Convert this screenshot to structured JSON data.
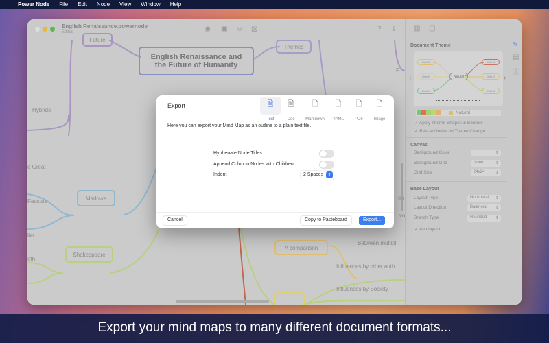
{
  "menubar": {
    "app": "Power Node",
    "items": [
      "File",
      "Edit",
      "Node",
      "View",
      "Window",
      "Help"
    ]
  },
  "window": {
    "title": "English Renaissance.powernode",
    "subtitle": "Edited"
  },
  "mindmap": {
    "central": "English Renaissance and the Future of Humanity",
    "nodes": {
      "future": "Future",
      "themes": "Themes",
      "marlowe": "Marlowe",
      "shakespeare": "Shakespeare",
      "comparison": "A comparison"
    },
    "labels": {
      "hybrids": "Hybrids",
      "great": "e Great",
      "faustus": "Faustus",
      "juliet": "liet",
      "macbeth": "eth",
      "f": "F",
      "between": "Between multipl",
      "influences_other": "Influences by other auth",
      "influences_society": "Influences by Society",
      "es": "es",
      "vo": "vo"
    }
  },
  "sidebar": {
    "document_theme": "Document Theme",
    "theme_preview": {
      "center": "Natural",
      "children": [
        "Child #2",
        "Child #4",
        "Child #6",
        "Child #1",
        "Child #3",
        "Child #5"
      ]
    },
    "theme_name": "Natural",
    "theme_colors": [
      "#7cc47c",
      "#e0705a",
      "#a8d070",
      "#b8d878",
      "#e8b070"
    ],
    "apply_shapes": "Apply Theme Shapes & Borders",
    "resize_nodes": "Resize Nodes on Theme Change",
    "canvas": "Canvas",
    "background_color": "Background Color",
    "background_grid": "Background Grid",
    "background_grid_value": "None",
    "grid_size": "Grid Size",
    "grid_size_value": "24x24",
    "base_layout": "Base Layout",
    "layout_type": "Layout Type",
    "layout_type_value": "Horizontal",
    "layout_direction": "Layout Direction",
    "layout_direction_value": "Balanced",
    "branch_type": "Branch Type",
    "branch_type_value": "Rounded",
    "autolayout": "Autolayout"
  },
  "dialog": {
    "title": "Export",
    "formats": [
      {
        "label": "Text",
        "selected": true
      },
      {
        "label": "Doc"
      },
      {
        "label": "Markdown"
      },
      {
        "label": "YAML"
      },
      {
        "label": "PDF"
      },
      {
        "label": "Image"
      }
    ],
    "description": "Here you can export your Mind Map as an outline to a plain text file.",
    "hyphenate": "Hyphenate Node Titles",
    "hyphenate_on": false,
    "append_colon": "Append Colon to Nodes with Children",
    "append_colon_on": false,
    "indent": "Indent",
    "indent_value": "2 Spaces",
    "cancel": "Cancel",
    "copy": "Copy to Pasteboard",
    "export": "Export..."
  },
  "caption": "Export your mind maps to many different document formats..."
}
